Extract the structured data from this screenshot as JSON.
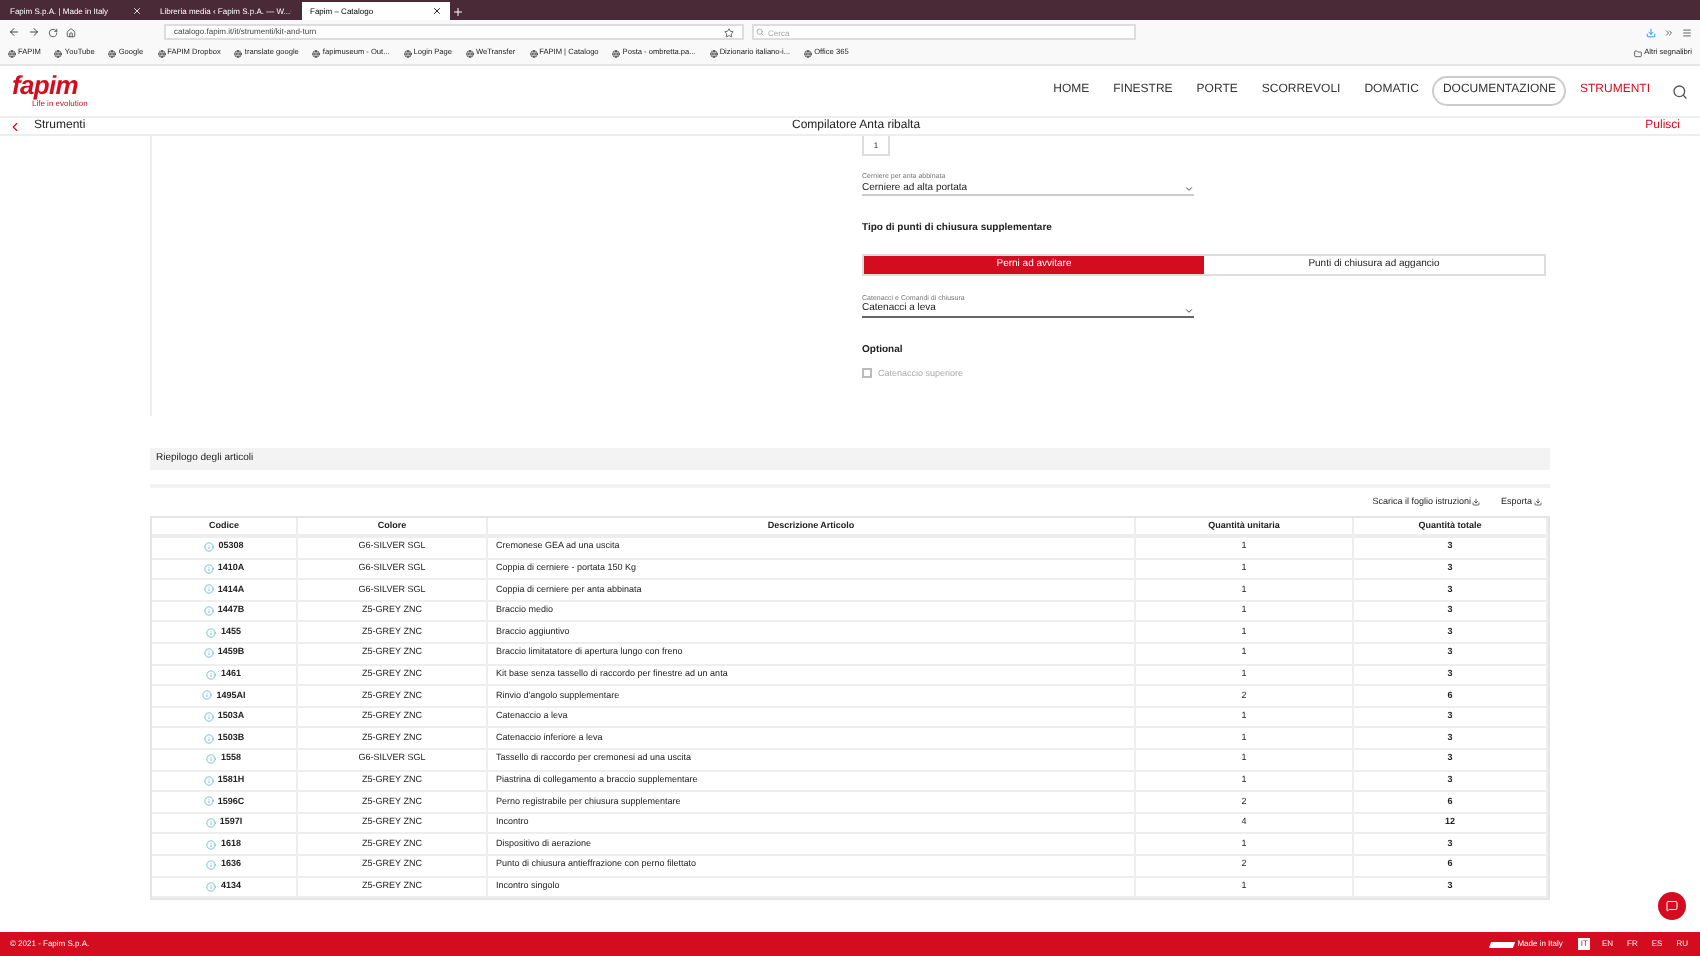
{
  "browser": {
    "tabs": [
      {
        "title": "Fapim S.p.A. | Made in Italy",
        "selected": false
      },
      {
        "title": "Libreria media ‹ Fapim S.p.A. — W...",
        "selected": false
      },
      {
        "title": "Fapim – Catalogo",
        "selected": true
      }
    ],
    "url": "catalogo.fapim.it/it/strumenti/kit-and-turn",
    "search_placeholder": "Cerca",
    "bookmarks": [
      "FAPIM",
      "YouTube",
      "Google",
      "FAPIM Dropbox",
      "translate google",
      "fapimuseum - Out...",
      "Login Page",
      "WeTransfer",
      "FAPIM | Catalogo",
      "Posta - ombretta.pa...",
      "Dizionario italiano-i...",
      "Office 365"
    ],
    "other_bookmarks": "Altri segnalibri"
  },
  "header": {
    "logo": "fapim",
    "tagline": "Life in evolution",
    "nav": [
      {
        "label": "HOME",
        "selected": false,
        "outlined": false
      },
      {
        "label": "FINESTRE",
        "selected": false,
        "outlined": false
      },
      {
        "label": "PORTE",
        "selected": false,
        "outlined": false
      },
      {
        "label": "SCORREVOLI",
        "selected": false,
        "outlined": false
      },
      {
        "label": "DOMATIC",
        "selected": false,
        "outlined": false
      },
      {
        "label": "DOCUMENTAZIONE",
        "selected": false,
        "outlined": true
      },
      {
        "label": "STRUMENTI",
        "selected": true,
        "outlined": false
      }
    ]
  },
  "subheader": {
    "back": "Strumenti",
    "title": "Compilatore Anta ribalta",
    "action": "Pulisci"
  },
  "form": {
    "quantity": "1",
    "hinge_select": {
      "label": "Cerniere per anta abbinata",
      "value": "Cerniere ad alta portata"
    },
    "closing_type": {
      "title": "Tipo di punti di chiusura supplementare",
      "options": [
        {
          "label": "Perni ad avvitare",
          "selected": true
        },
        {
          "label": "Punti di chiusura ad aggancio",
          "selected": false
        }
      ]
    },
    "lock_select": {
      "label": "Catenacci e Comandi di chiusura",
      "value": "Catenacci a leva"
    },
    "optional": {
      "title": "Optional",
      "options": [
        {
          "label": "Catenaccio superiore",
          "checked": false
        }
      ]
    }
  },
  "summary": {
    "title": "Riepilogo degli articoli",
    "links": [
      "Scarica il foglio istruzioni",
      "Esporta"
    ],
    "columns": [
      "Codice",
      "Colore",
      "Descrizione Articolo",
      "Quantità unitaria",
      "Quantità totale"
    ],
    "rows": [
      [
        "05308",
        "G6-SILVER SGL",
        "Cremonese GEA ad una uscita",
        "1",
        "3"
      ],
      [
        "1410A",
        "G6-SILVER SGL",
        "Coppia di cerniere - portata 150 Kg",
        "1",
        "3"
      ],
      [
        "1414A",
        "G6-SILVER SGL",
        "Coppia di cerniere per anta abbinata",
        "1",
        "3"
      ],
      [
        "1447B",
        "Z5-GREY ZNC",
        "Braccio medio",
        "1",
        "3"
      ],
      [
        "1455",
        "Z5-GREY ZNC",
        "Braccio aggiuntivo",
        "1",
        "3"
      ],
      [
        "1459B",
        "Z5-GREY ZNC",
        "Braccio limitatatore di apertura lungo con freno",
        "1",
        "3"
      ],
      [
        "1461",
        "Z5-GREY ZNC",
        "Kit base senza tassello di raccordo per finestre ad un anta",
        "1",
        "3"
      ],
      [
        "1495AI",
        "Z5-GREY ZNC",
        "Rinvio d'angolo supplementare",
        "2",
        "6"
      ],
      [
        "1503A",
        "Z5-GREY ZNC",
        "Catenaccio a leva",
        "1",
        "3"
      ],
      [
        "1503B",
        "Z5-GREY ZNC",
        "Catenaccio inferiore a leva",
        "1",
        "3"
      ],
      [
        "1558",
        "G6-SILVER SGL",
        "Tassello di raccordo per cremonesi ad una uscita",
        "1",
        "3"
      ],
      [
        "1581H",
        "Z5-GREY ZNC",
        "Piastrina di collegamento a braccio supplementare",
        "1",
        "3"
      ],
      [
        "1596C",
        "Z5-GREY ZNC",
        "Perno registrabile per chiusura supplementare",
        "2",
        "6"
      ],
      [
        "1597I",
        "Z5-GREY ZNC",
        "Incontro",
        "4",
        "12"
      ],
      [
        "1618",
        "Z5-GREY ZNC",
        "Dispositivo di aerazione",
        "1",
        "3"
      ],
      [
        "1636",
        "Z5-GREY ZNC",
        "Punto di chiusura antieffrazione con perno filettato",
        "2",
        "6"
      ],
      [
        "4134",
        "Z5-GREY ZNC",
        "Incontro singolo",
        "1",
        "3"
      ]
    ]
  },
  "footer": {
    "copyright": "© 2021 - Fapim S.p.A.",
    "made_in": "Made in Italy",
    "languages": [
      {
        "label": "IT",
        "selected": true
      },
      {
        "label": "EN",
        "selected": false
      },
      {
        "label": "FR",
        "selected": false
      },
      {
        "label": "ES",
        "selected": false
      },
      {
        "label": "RU",
        "selected": false
      }
    ]
  }
}
